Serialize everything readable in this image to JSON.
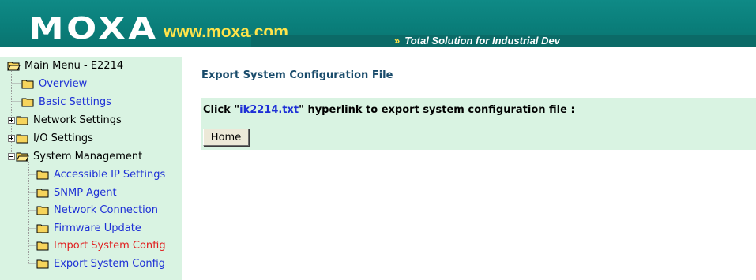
{
  "header": {
    "brand": "MOXA",
    "url": "www.moxa.com",
    "tagline_prefix": "»",
    "tagline": "Total Solution for Industrial Dev"
  },
  "sidebar": {
    "root_label": "Main Menu - E2214",
    "items": [
      {
        "label": "Overview",
        "style": "link"
      },
      {
        "label": "Basic Settings",
        "style": "link"
      },
      {
        "label": "Network Settings",
        "style": "plain"
      },
      {
        "label": "I/O Settings",
        "style": "plain"
      },
      {
        "label": "System Management",
        "style": "plain"
      }
    ],
    "sub_items": [
      {
        "label": "Accessible IP Settings"
      },
      {
        "label": "SNMP Agent"
      },
      {
        "label": "Network Connection"
      },
      {
        "label": "Firmware Update"
      },
      {
        "label": "Import System Config"
      },
      {
        "label": "Export System Config"
      }
    ]
  },
  "main": {
    "title": "Export System Configuration File",
    "instruction_prefix": "Click \"",
    "file_link": "ik2214.txt",
    "instruction_suffix": "\" hyperlink to export system configuration file :",
    "home_button": "Home"
  },
  "colors": {
    "header_teal": "#0a7e7a",
    "brand_yellow": "#ffe34a",
    "panel_green": "#d9f3e2",
    "link_blue": "#1d2fd6",
    "active_red": "#e02020",
    "title_navy": "#194b6b"
  },
  "icons": {
    "folder": "folder-icon",
    "open_folder": "open-folder-icon",
    "expand": "plus-box-icon",
    "collapse": "minus-box-icon"
  }
}
